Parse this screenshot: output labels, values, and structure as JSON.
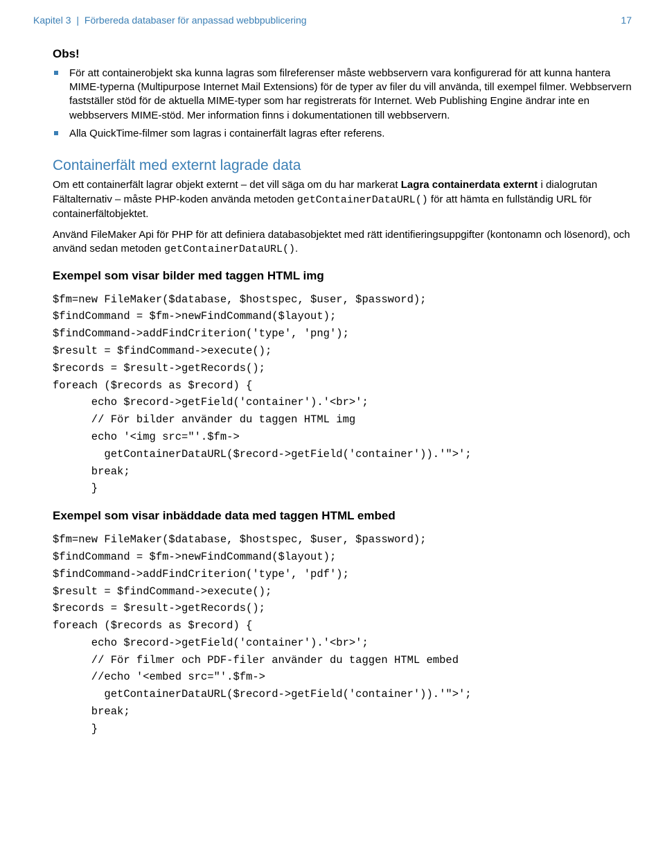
{
  "header": {
    "chapter": "Kapitel 3",
    "bar": "|",
    "title": "Förbereda databaser för anpassad webbpublicering",
    "page": "17"
  },
  "note_heading": "Obs!",
  "bullets": [
    "För att containerobjekt ska kunna lagras som filreferenser måste webbservern vara konfigurerad för att kunna hantera MIME-typerna (Multipurpose Internet Mail Extensions) för de typer av filer du vill använda, till exempel filmer. Webbservern fastställer stöd för de aktuella MIME-typer som har registrerats för Internet. Web Publishing Engine ändrar inte en webbservers MIME-stöd. Mer information finns i dokumentationen till webbservern.",
    "Alla QuickTime-filmer som lagras i containerfält lagras efter referens."
  ],
  "section_heading": "Containerfält med externt lagrade data",
  "p1_a": "Om ett containerfält lagrar objekt externt – det vill säga om du har markerat ",
  "p1_b": "Lagra containerdata externt",
  "p1_c": " i dialogrutan Fältalternativ – måste PHP-koden använda metoden ",
  "p1_code1": "getContainerDataURL()",
  "p1_d": " för att hämta en fullständig URL för containerfältobjektet.",
  "p2_a": "Använd FileMaker Api för PHP för att definiera databasobjektet med rätt identifieringsuppgifter (kontonamn och lösenord), och använd sedan metoden ",
  "p2_code": "getContainerDataURL()",
  "p2_b": ".",
  "ex1_heading": "Exempel som visar bilder med taggen HTML img",
  "ex1_code": "$fm=new FileMaker($database, $hostspec, $user, $password);\n$findCommand = $fm->newFindCommand($layout);\n$findCommand->addFindCriterion('type', 'png');\n$result = $findCommand->execute();\n$records = $result->getRecords();\nforeach ($records as $record) {\n      echo $record->getField('container').'<br>';\n      // För bilder använder du taggen HTML img\n      echo '<img src=\"'.$fm->\n        getContainerDataURL($record->getField('container')).'\">';\n      break;\n      }",
  "ex2_heading": "Exempel som visar inbäddade data med taggen HTML embed",
  "ex2_code": "$fm=new FileMaker($database, $hostspec, $user, $password);\n$findCommand = $fm->newFindCommand($layout);\n$findCommand->addFindCriterion('type', 'pdf');\n$result = $findCommand->execute();\n$records = $result->getRecords();\nforeach ($records as $record) {\n      echo $record->getField('container').'<br>';\n      // För filmer och PDF-filer använder du taggen HTML embed\n      //echo '<embed src=\"'.$fm->\n        getContainerDataURL($record->getField('container')).'\">';\n      break;\n      }"
}
